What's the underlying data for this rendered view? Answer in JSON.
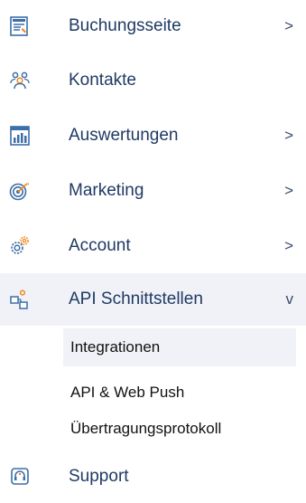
{
  "menu": {
    "items": [
      {
        "label": "Buchungsseite",
        "chevron": ">",
        "icon": "booking-page-icon"
      },
      {
        "label": "Kontakte",
        "chevron": "",
        "icon": "contacts-icon"
      },
      {
        "label": "Auswertungen",
        "chevron": ">",
        "icon": "reports-icon"
      },
      {
        "label": "Marketing",
        "chevron": ">",
        "icon": "marketing-target-icon"
      },
      {
        "label": "Account",
        "chevron": ">",
        "icon": "account-gears-icon"
      },
      {
        "label": "API Schnittstellen",
        "chevron": "v",
        "icon": "api-icon"
      }
    ],
    "subitems": [
      {
        "label": "Integrationen"
      },
      {
        "label": "API & Web Push"
      },
      {
        "label": "Übertragungsprotokoll"
      }
    ],
    "support": {
      "label": "Support",
      "icon": "support-headset-icon"
    }
  },
  "colors": {
    "text": "#1f3a63",
    "active_bg": "#f1f2f8",
    "icon_blue": "#3c6ea8",
    "icon_orange": "#f08a24"
  }
}
